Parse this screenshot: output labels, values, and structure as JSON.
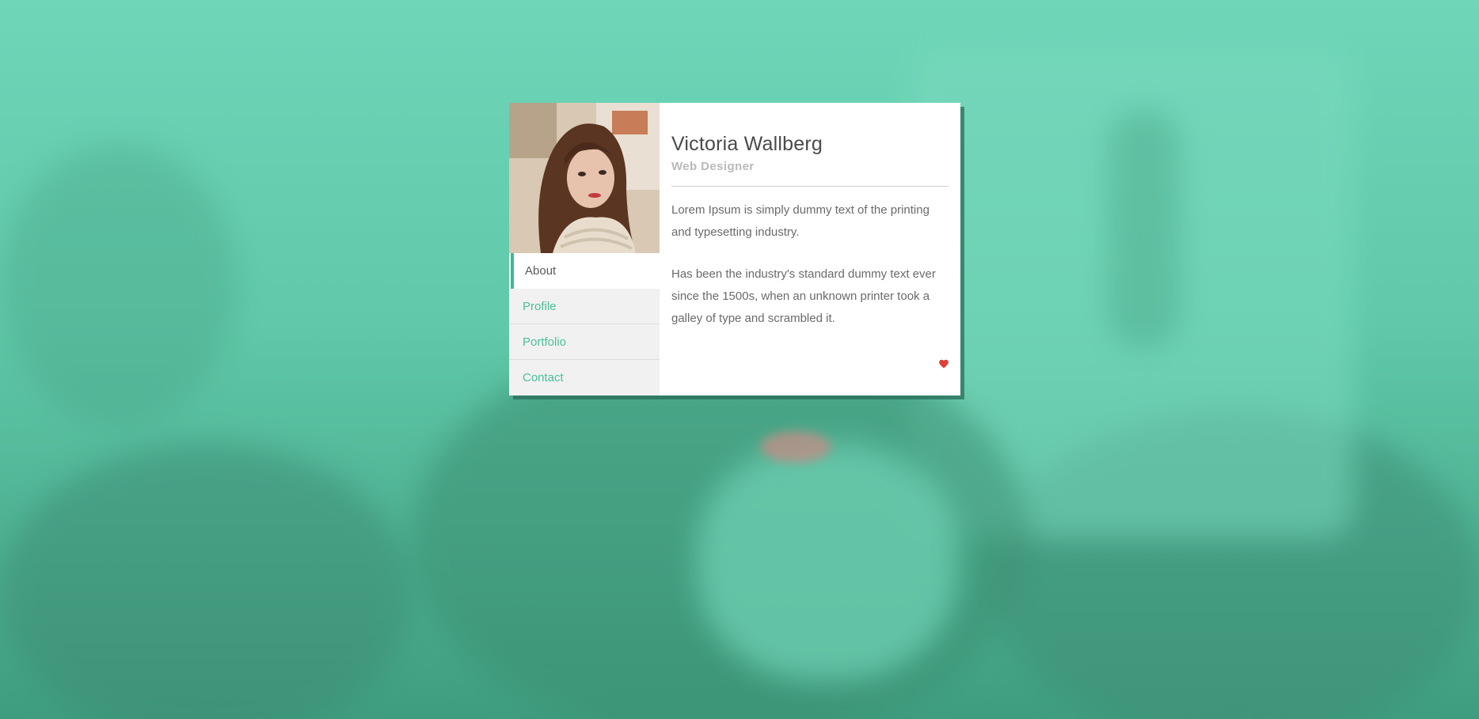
{
  "profile": {
    "name": "Victoria Wallberg",
    "role": "Web Designer",
    "paragraphs": [
      "Lorem Ipsum is simply dummy text of the printing and typesetting industry.",
      "Has been the industry's standard dummy text ever since the 1500s, when an unknown printer took a galley of type and scrambled it."
    ]
  },
  "nav": {
    "items": [
      {
        "label": "About",
        "active": true
      },
      {
        "label": "Profile",
        "active": false
      },
      {
        "label": "Portfolio",
        "active": false
      },
      {
        "label": "Contact",
        "active": false
      }
    ]
  },
  "icons": {
    "like": "heart-icon",
    "photo": "profile-photo"
  },
  "colors": {
    "accent": "#4bbf9c",
    "heart": "#e0403a",
    "background_tint": "#6fd6b8"
  }
}
